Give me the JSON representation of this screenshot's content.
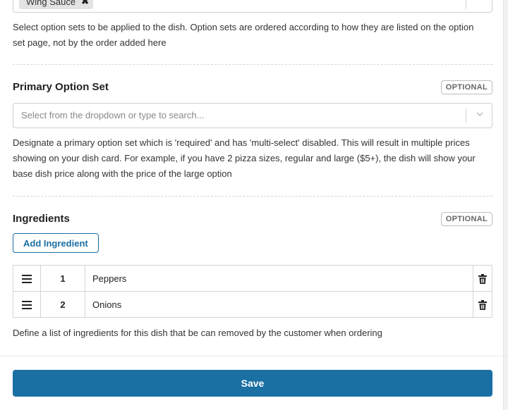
{
  "option_sets": {
    "selected_chip": "Wing Sauce",
    "help": "Select option sets to be applied to the dish. Option sets are ordered according to how they are listed on the option set page, not by the order added here"
  },
  "primary_option_set": {
    "title": "Primary Option Set",
    "badge": "OPTIONAL",
    "placeholder": "Select from the dropdown or type to search...",
    "help": "Designate a primary option set which is 'required' and has 'multi-select' disabled. This will result in multiple prices showing on your dish card. For example, if you have 2 pizza sizes, regular and large ($5+), the dish will show your base dish price along with the price of the large option"
  },
  "ingredients": {
    "title": "Ingredients",
    "badge": "OPTIONAL",
    "add_label": "Add Ingredient",
    "rows": [
      {
        "num": "1",
        "name": "Peppers"
      },
      {
        "num": "2",
        "name": "Onions"
      }
    ],
    "help": "Define a list of ingredients for this dish that be can removed by the customer when ordering"
  },
  "footer": {
    "save_label": "Save"
  },
  "colors": {
    "primary": "#1a6fa3",
    "border": "#d4d4d4"
  }
}
